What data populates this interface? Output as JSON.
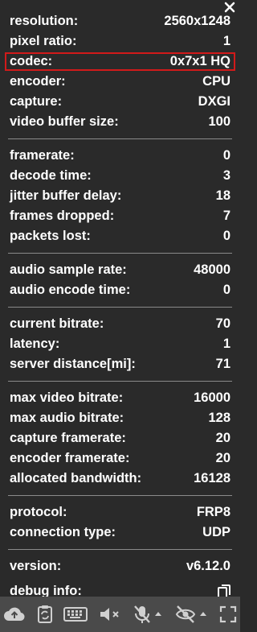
{
  "stats": {
    "group1": [
      {
        "label": "resolution:",
        "value": "2560x1248"
      },
      {
        "label": "pixel ratio:",
        "value": "1"
      },
      {
        "label": "codec:",
        "value": "0x7x1 HQ"
      },
      {
        "label": "encoder:",
        "value": "CPU"
      },
      {
        "label": "capture:",
        "value": "DXGI"
      },
      {
        "label": "video buffer size:",
        "value": "100"
      }
    ],
    "group2": [
      {
        "label": "framerate:",
        "value": "0"
      },
      {
        "label": "decode time:",
        "value": "3"
      },
      {
        "label": "jitter buffer delay:",
        "value": "18"
      },
      {
        "label": "frames dropped:",
        "value": "7"
      },
      {
        "label": "packets lost:",
        "value": "0"
      }
    ],
    "group3": [
      {
        "label": "audio sample rate:",
        "value": "48000"
      },
      {
        "label": "audio encode time:",
        "value": "0"
      }
    ],
    "group4": [
      {
        "label": "current bitrate:",
        "value": "70"
      },
      {
        "label": "latency:",
        "value": "1"
      },
      {
        "label": "server distance[mi]:",
        "value": "71"
      }
    ],
    "group5": [
      {
        "label": "max video bitrate:",
        "value": "16000"
      },
      {
        "label": "max audio bitrate:",
        "value": "128"
      },
      {
        "label": "capture framerate:",
        "value": "20"
      },
      {
        "label": "encoder framerate:",
        "value": "20"
      },
      {
        "label": "allocated bandwidth:",
        "value": "16128"
      }
    ],
    "group6": [
      {
        "label": "protocol:",
        "value": "FRP8"
      },
      {
        "label": "connection type:",
        "value": "UDP"
      }
    ],
    "group7": [
      {
        "label": "version:",
        "value": "v6.12.0"
      }
    ],
    "debug_label": "debug info:"
  },
  "icons": {
    "close": "close-icon",
    "copy": "copy-icon",
    "toolbar": [
      "cloud-upload-icon",
      "clipboard-sync-icon",
      "keyboard-icon",
      "speaker-muted-icon",
      "microphone-off-icon",
      "camera-off-icon",
      "fullscreen-icon"
    ]
  },
  "colors": {
    "background": "#2a2a2a",
    "toolbar": "#4a4a4a",
    "highlight": "#d21a1a",
    "text": "#ffffff"
  }
}
